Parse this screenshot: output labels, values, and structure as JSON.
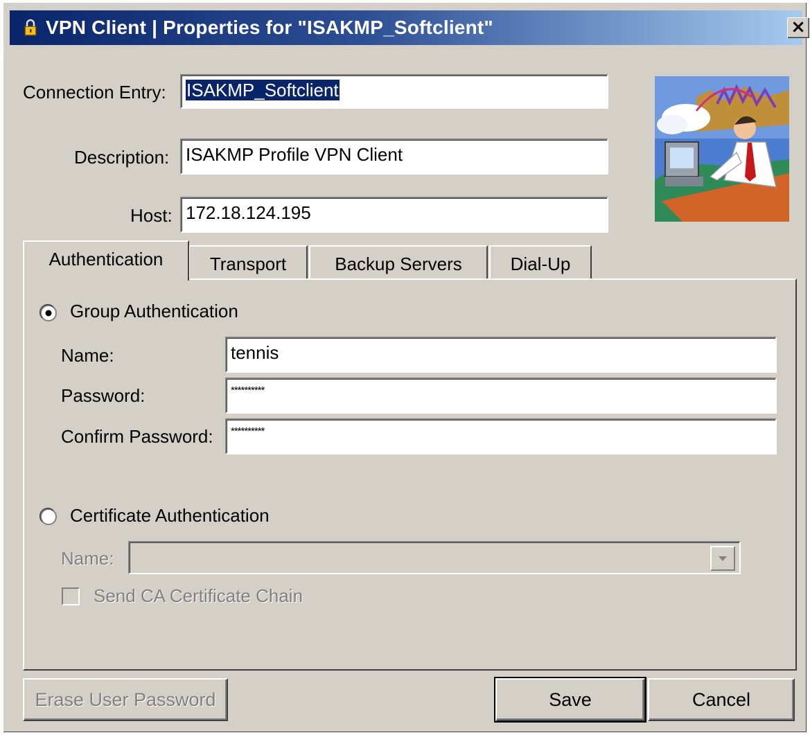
{
  "window": {
    "title": "VPN Client  |  Properties for \"ISAKMP_Softclient\"",
    "close_glyph": "×"
  },
  "fields": {
    "connection_entry": {
      "label": "Connection Entry:",
      "value": "ISAKMP_Softclient"
    },
    "description": {
      "label": "Description:",
      "value": "ISAKMP Profile VPN Client"
    },
    "host": {
      "label": "Host:",
      "value": "172.18.124.195"
    }
  },
  "tabs": [
    {
      "label": "Authentication",
      "active": true
    },
    {
      "label": "Transport",
      "active": false
    },
    {
      "label": "Backup Servers",
      "active": false
    },
    {
      "label": "Dial-Up",
      "active": false
    }
  ],
  "auth": {
    "group": {
      "radio_label": "Group Authentication",
      "selected": true,
      "name_label": "Name:",
      "name_value": "tennis",
      "password_label": "Password:",
      "password_value": "**********",
      "confirm_label": "Confirm Password:",
      "confirm_value": "**********"
    },
    "certificate": {
      "radio_label": "Certificate Authentication",
      "selected": false,
      "name_label": "Name:",
      "name_value": "",
      "send_chain_label": "Send CA Certificate Chain",
      "send_chain_checked": false
    }
  },
  "buttons": {
    "erase": "Erase User Password",
    "save": "Save",
    "cancel": "Cancel"
  },
  "colors": {
    "title_gradient_start": "#0a246a",
    "title_gradient_end": "#a6caf0",
    "dialog_face": "#d4d0c8",
    "selection": "#0a246a"
  },
  "icons": {
    "title": "vpn-lock-icon",
    "illustration": "man-at-computer-illustration"
  }
}
